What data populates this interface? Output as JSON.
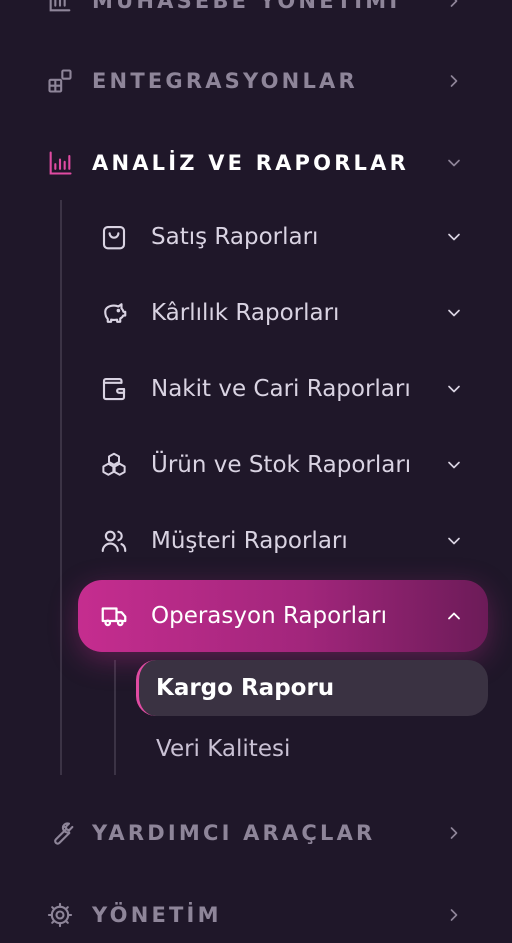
{
  "nav": {
    "muhasebe_label": "MUHASEBE YÖNETİMİ",
    "entegrasyonlar_label": "ENTEGRASYONLAR",
    "analiz_label": "ANALİZ VE RAPORLAR",
    "yardimci_label": "YARDIMCI ARAÇLAR",
    "yonetim_label": "YÖNETİM"
  },
  "reports": {
    "items": [
      {
        "label": "Satış Raporları",
        "icon": "shopping-bag-icon"
      },
      {
        "label": "Kârlılık Raporları",
        "icon": "piggy-bank-icon"
      },
      {
        "label": "Nakit ve Cari Raporları",
        "icon": "wallet-icon"
      },
      {
        "label": "Ürün ve Stok Raporları",
        "icon": "boxes-icon"
      },
      {
        "label": "Müşteri Raporları",
        "icon": "users-icon"
      },
      {
        "label": "Operasyon Raporları",
        "icon": "truck-icon"
      }
    ],
    "sub_items": [
      {
        "label": "Kargo Raporu"
      },
      {
        "label": "Veri Kalitesi"
      }
    ]
  },
  "colors": {
    "background": "#1f1729",
    "accent": "#c52d8f",
    "accent_pink": "#e04ba2",
    "muted_text": "#8e8599"
  }
}
